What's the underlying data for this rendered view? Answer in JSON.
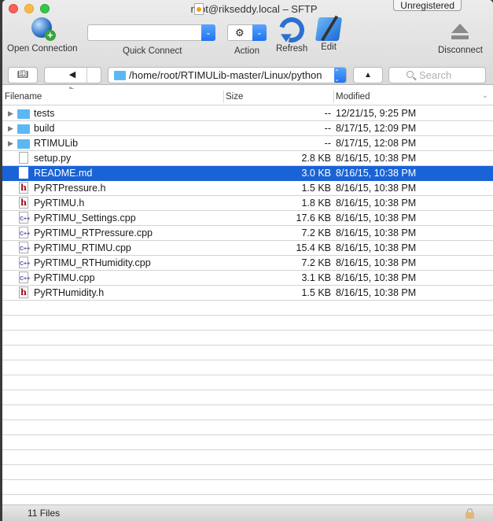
{
  "window": {
    "title": "root@rikseddy.local – SFTP",
    "badge": "Unregistered"
  },
  "toolbar": {
    "open_connection": "Open Connection",
    "quick_connect": "Quick Connect",
    "quick_connect_value": "",
    "action": "Action",
    "refresh": "Refresh",
    "edit": "Edit",
    "disconnect": "Disconnect"
  },
  "navbar": {
    "back_glyph": "◀",
    "forward_glyph": "▶",
    "up_glyph": "▲",
    "path": "/home/root/RTIMULib-master/Linux/python",
    "search_placeholder": "Search"
  },
  "columns": {
    "filename": "Filename",
    "size": "Size",
    "modified": "Modified"
  },
  "files": [
    {
      "name": "tests",
      "type": "folder",
      "size": "--",
      "modified": "12/21/15, 9:25 PM"
    },
    {
      "name": "build",
      "type": "folder",
      "size": "--",
      "modified": "8/17/15, 12:09 PM"
    },
    {
      "name": "RTIMULib",
      "type": "folder",
      "size": "--",
      "modified": "8/17/15, 12:08 PM"
    },
    {
      "name": "setup.py",
      "type": "doc",
      "size": "2.8 KB",
      "modified": "8/16/15, 10:38 PM"
    },
    {
      "name": "README.md",
      "type": "doc",
      "size": "3.0 KB",
      "modified": "8/16/15, 10:38 PM",
      "selected": true
    },
    {
      "name": "PyRTPressure.h",
      "type": "h",
      "size": "1.5 KB",
      "modified": "8/16/15, 10:38 PM"
    },
    {
      "name": "PyRTIMU.h",
      "type": "h",
      "size": "1.8 KB",
      "modified": "8/16/15, 10:38 PM"
    },
    {
      "name": "PyRTIMU_Settings.cpp",
      "type": "cpp",
      "size": "17.6 KB",
      "modified": "8/16/15, 10:38 PM"
    },
    {
      "name": "PyRTIMU_RTPressure.cpp",
      "type": "cpp",
      "size": "7.2 KB",
      "modified": "8/16/15, 10:38 PM"
    },
    {
      "name": "PyRTIMU_RTIMU.cpp",
      "type": "cpp",
      "size": "15.4 KB",
      "modified": "8/16/15, 10:38 PM"
    },
    {
      "name": "PyRTIMU_RTHumidity.cpp",
      "type": "cpp",
      "size": "7.2 KB",
      "modified": "8/16/15, 10:38 PM"
    },
    {
      "name": "PyRTIMU.cpp",
      "type": "cpp",
      "size": "3.1 KB",
      "modified": "8/16/15, 10:38 PM"
    },
    {
      "name": "PyRTHumidity.h",
      "type": "h",
      "size": "1.5 KB",
      "modified": "8/16/15, 10:38 PM"
    }
  ],
  "status": {
    "count": "11 Files"
  }
}
